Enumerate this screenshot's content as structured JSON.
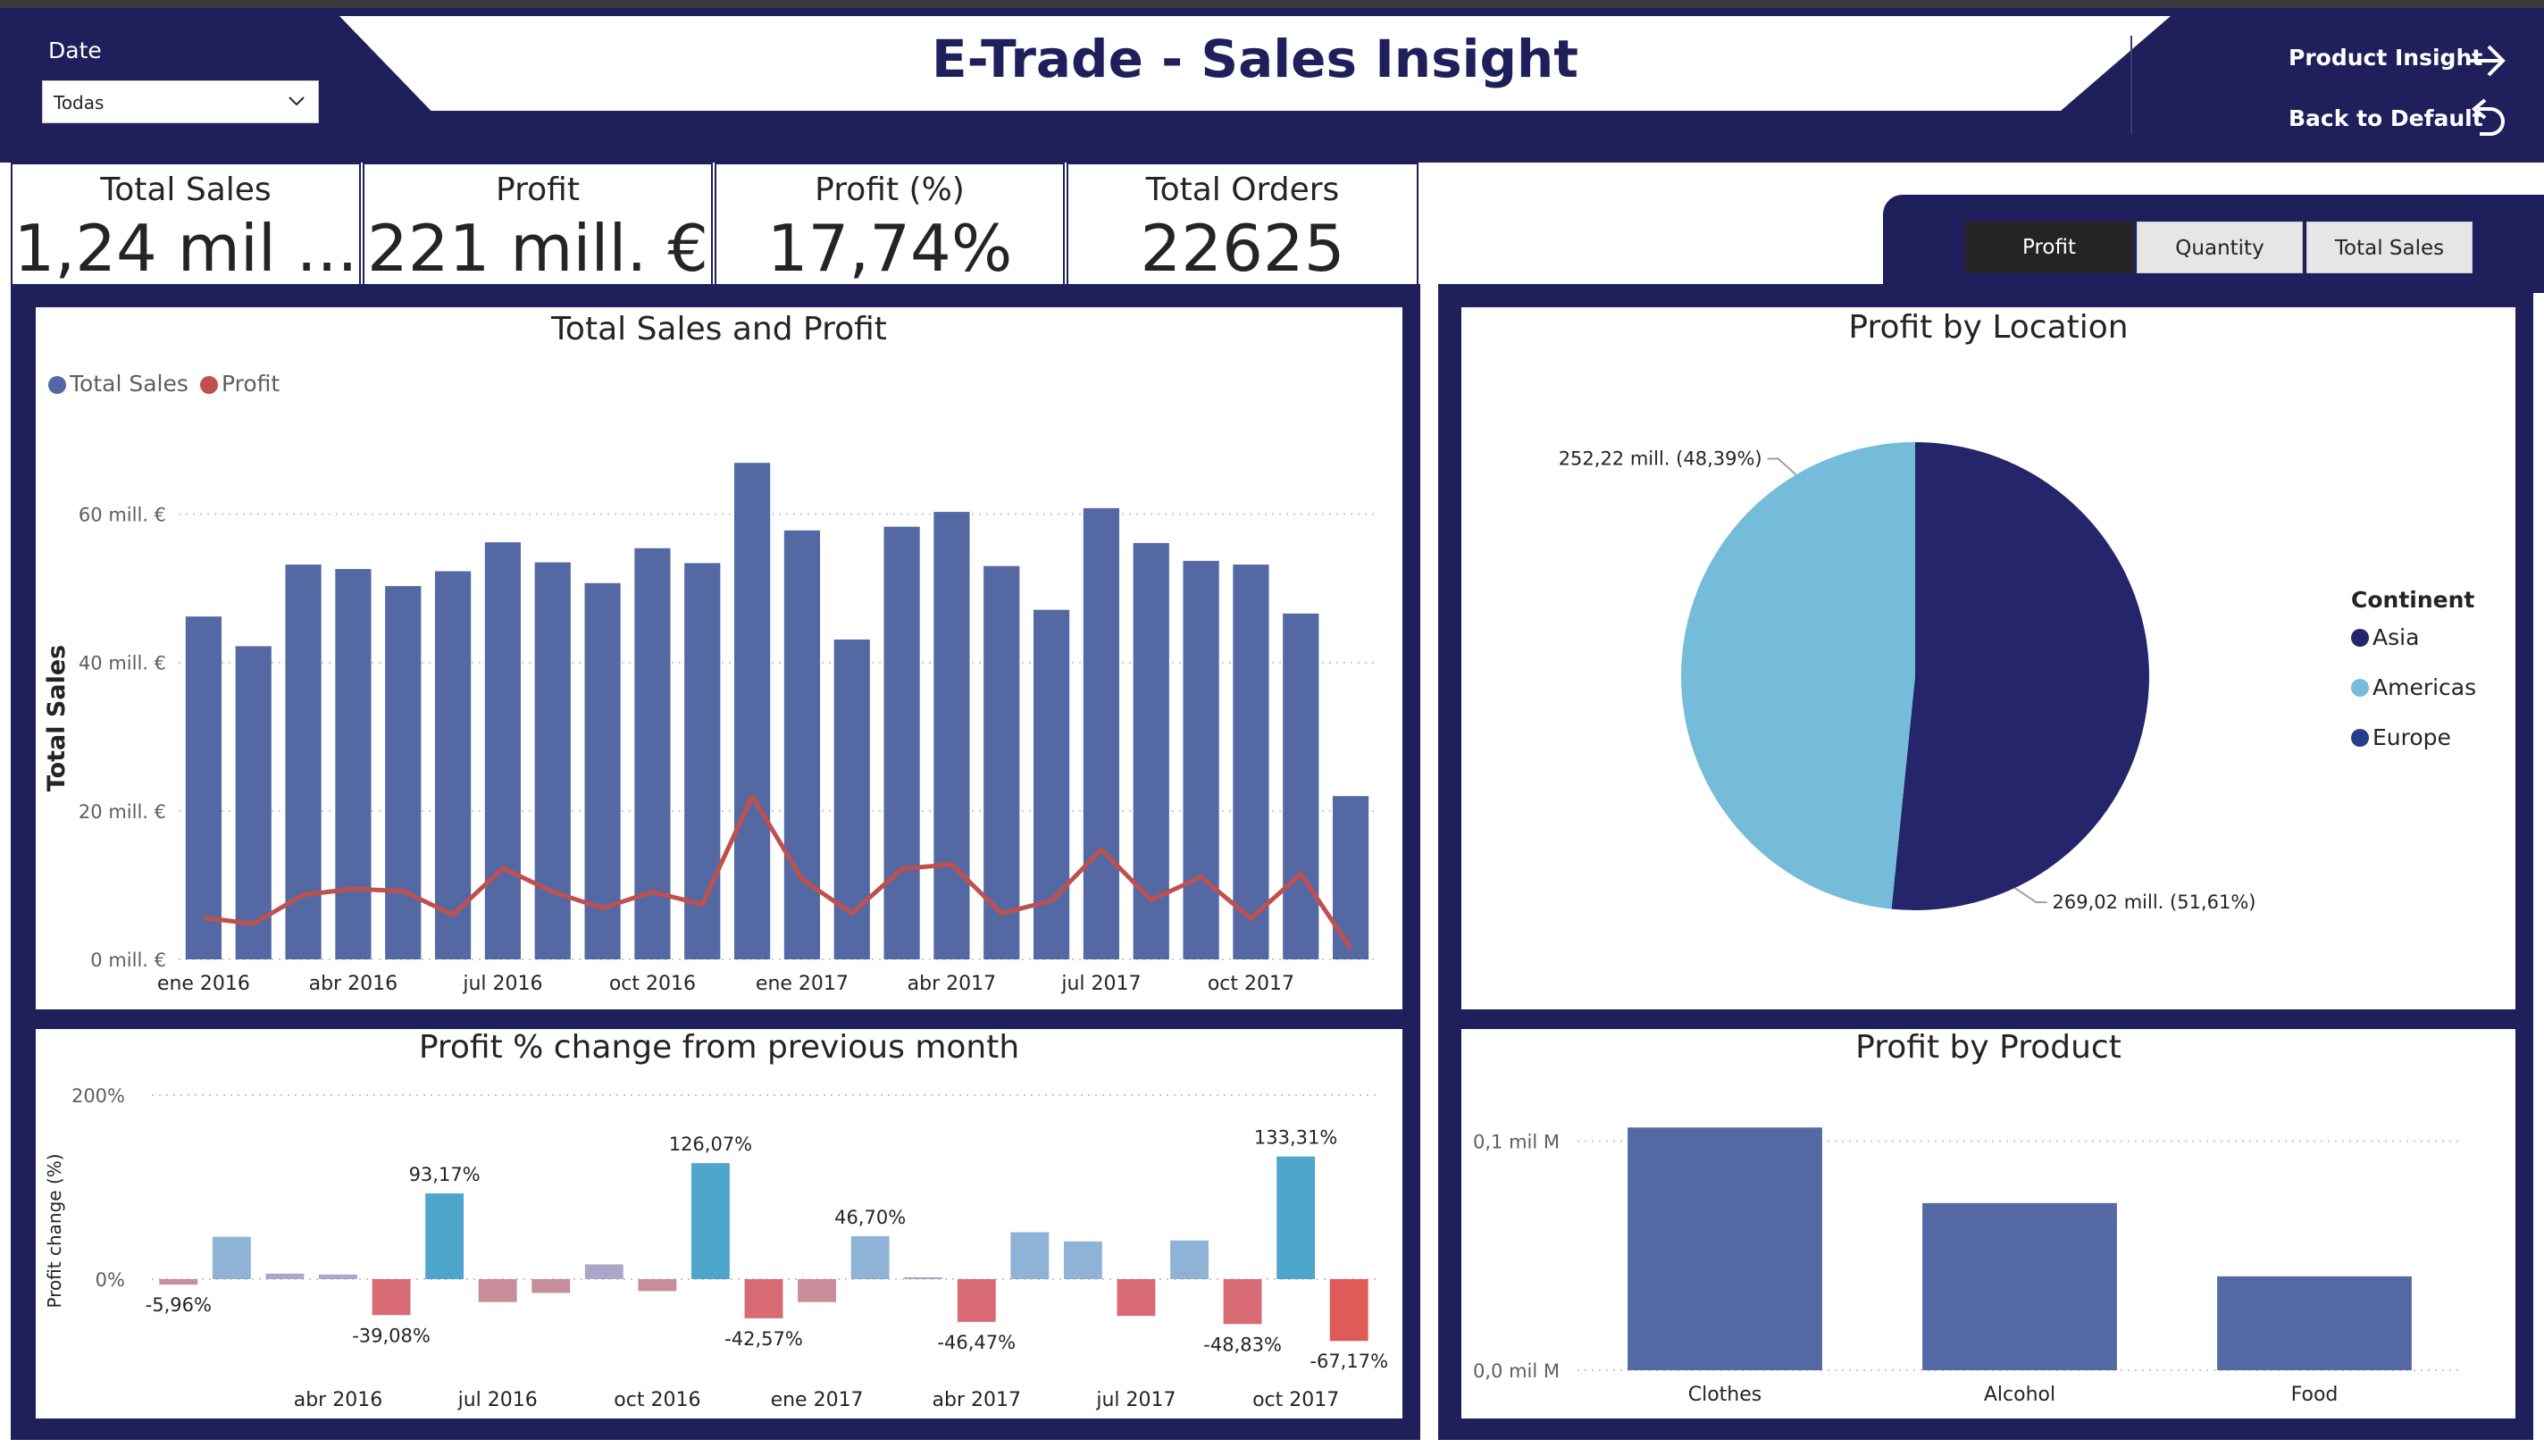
{
  "header": {
    "title": "E-Trade - Sales Insight",
    "date_label": "Date",
    "date_value": "Todas",
    "nav_product_insight": "Product Insight",
    "nav_back_default": "Back to Default"
  },
  "cards": [
    {
      "label": "Total Sales",
      "value": "1,24 mil ..."
    },
    {
      "label": "Profit",
      "value": "221 mill. €"
    },
    {
      "label": "Profit (%)",
      "value": "17,74%"
    },
    {
      "label": "Total Orders",
      "value": "22625"
    }
  ],
  "tabs": [
    {
      "label": "Profit",
      "active": true
    },
    {
      "label": "Quantity",
      "active": false
    },
    {
      "label": "Total Sales",
      "active": false
    }
  ],
  "colors": {
    "navy": "#1f1f5c",
    "bar_blue": "#5469a4",
    "profit_line": "#c0504d",
    "pie_asia": "#24256b",
    "pie_americas": "#74bcd9",
    "pie_europe": "#253f8c"
  },
  "chart_data": [
    {
      "type": "bar",
      "title": "Total Sales and Profit",
      "ylabel": "Total Sales",
      "legend_position": "top-left",
      "legend": [
        "Total Sales",
        "Profit"
      ],
      "ylim": [
        0,
        65
      ],
      "yticks": [
        0,
        20,
        40,
        60
      ],
      "ytick_labels": [
        "0 mill. €",
        "20 mill. €",
        "40 mill. €",
        "60 mill. €"
      ],
      "xtick_labels": [
        {
          "index": 0,
          "label": "ene 2016"
        },
        {
          "index": 3,
          "label": "abr 2016"
        },
        {
          "index": 6,
          "label": "jul 2016"
        },
        {
          "index": 9,
          "label": "oct 2016"
        },
        {
          "index": 12,
          "label": "ene 2017"
        },
        {
          "index": 15,
          "label": "abr 2017"
        },
        {
          "index": 18,
          "label": "jul 2017"
        },
        {
          "index": 21,
          "label": "oct 2017"
        }
      ],
      "series": [
        {
          "name": "Total Sales",
          "mark": "bar",
          "values": [
            46.2,
            42.2,
            53.2,
            52.6,
            50.3,
            52.3,
            56.2,
            53.5,
            50.7,
            55.4,
            53.4,
            66.9,
            57.8,
            43.1,
            58.3,
            60.3,
            53.0,
            47.1,
            60.8,
            56.1,
            53.7,
            53.2,
            46.6,
            22.0
          ]
        },
        {
          "name": "Profit",
          "mark": "line",
          "values": [
            5.6,
            4.8,
            8.7,
            9.5,
            9.2,
            6.0,
            12.3,
            9.1,
            6.9,
            9.1,
            7.4,
            22.0,
            10.8,
            6.2,
            12.2,
            12.8,
            6.2,
            7.9,
            14.8,
            8.0,
            11.1,
            5.5,
            11.5,
            1.5
          ]
        }
      ]
    },
    {
      "type": "bar",
      "title": "Profit % change from previous month",
      "ylabel": "Profit change (%)",
      "ylim": [
        -70,
        200
      ],
      "yticks": [
        0,
        200
      ],
      "ytick_labels": [
        "0%",
        "200%"
      ],
      "xtick_labels": [
        {
          "index": 3,
          "label": "abr 2016"
        },
        {
          "index": 6,
          "label": "jul 2016"
        },
        {
          "index": 9,
          "label": "oct 2016"
        },
        {
          "index": 12,
          "label": "ene 2017"
        },
        {
          "index": 15,
          "label": "abr 2017"
        },
        {
          "index": 18,
          "label": "jul 2017"
        },
        {
          "index": 21,
          "label": "oct 2017"
        }
      ],
      "values": [
        -5.96,
        46.0,
        6.0,
        5.0,
        -39.08,
        93.17,
        -25.0,
        -15.0,
        16.0,
        -13.0,
        126.07,
        -42.57,
        -25.0,
        46.7,
        2.0,
        -46.47,
        51.0,
        41.0,
        -40.0,
        42.0,
        -48.83,
        133.31,
        -67.17
      ],
      "data_labels": [
        {
          "index": 0,
          "text": "-5,96%"
        },
        {
          "index": 4,
          "text": "-39,08%"
        },
        {
          "index": 5,
          "text": "93,17%"
        },
        {
          "index": 10,
          "text": "126,07%"
        },
        {
          "index": 11,
          "text": "-42,57%"
        },
        {
          "index": 13,
          "text": "46,70%"
        },
        {
          "index": 15,
          "text": "-46,47%"
        },
        {
          "index": 20,
          "text": "-48,83%"
        },
        {
          "index": 21,
          "text": "133,31%"
        },
        {
          "index": 22,
          "text": "-67,17%"
        }
      ]
    },
    {
      "type": "pie",
      "title": "Profit by Location",
      "legend_title": "Continent",
      "legend_position": "right",
      "legend": [
        "Asia",
        "Americas",
        "Europe"
      ],
      "slices": [
        {
          "name": "Asia",
          "value": 269.02,
          "label": "269,02 mill. (51,61%)"
        },
        {
          "name": "Americas",
          "value": 252.22,
          "label": "252,22 mill. (48,39%)"
        }
      ]
    },
    {
      "type": "bar",
      "title": "Profit by Product",
      "categories": [
        "Clothes",
        "Alcohol",
        "Food"
      ],
      "values": [
        0.106,
        0.073,
        0.041
      ],
      "ylim": [
        0,
        0.11
      ],
      "yticks": [
        0,
        0.1
      ],
      "ytick_labels": [
        "0,0 mil M",
        "0,1 mil M"
      ]
    }
  ]
}
